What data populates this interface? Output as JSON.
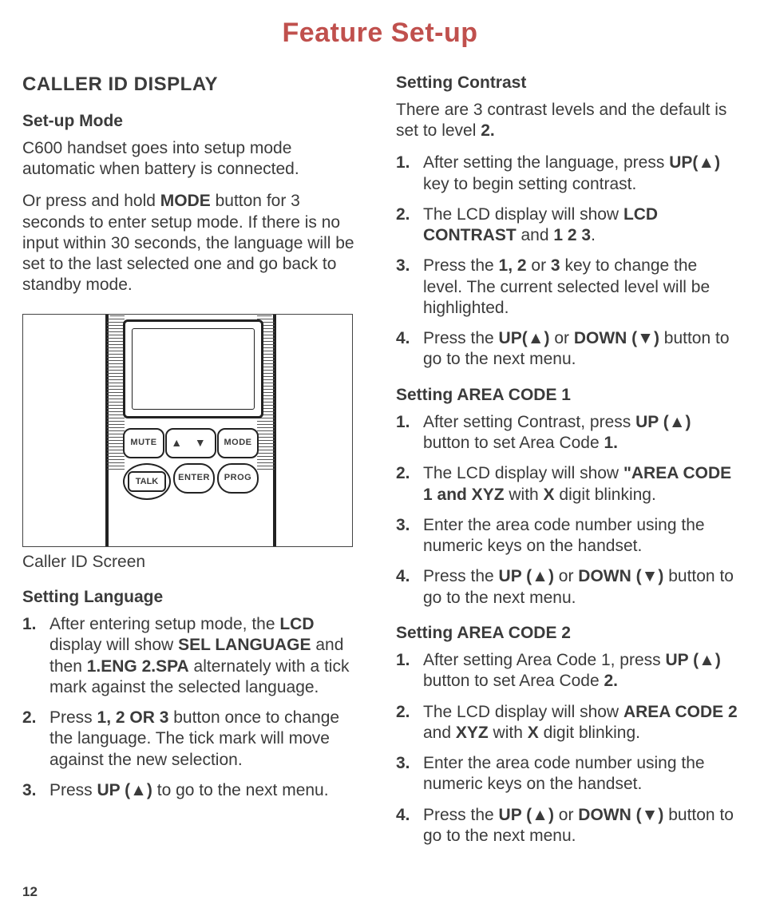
{
  "title": "Feature Set-up",
  "pageNumber": "12",
  "left": {
    "h2": "CALLER ID DISPLAY",
    "setupMode": {
      "heading": "Set-up Mode",
      "p1_a": "C600 handset goes into setup mode automatic when battery is connected.",
      "p2_a": "Or press and hold ",
      "p2_b": "MODE",
      "p2_c": " button for 3 seconds to enter setup mode. If there is no input within 30 seconds, the language will be set to the last selected one and go back to standby mode."
    },
    "device": {
      "btnMute": "MUTE",
      "btnMode": "MODE",
      "btnTalk": "TALK",
      "btnEnter": "ENTER",
      "btnProg": "PROG"
    },
    "caption": "Caller ID Screen",
    "lang": {
      "heading": "Setting Language",
      "i1_a": "After entering setup mode, the ",
      "i1_b": "LCD",
      "i1_c": " display will show ",
      "i1_d": "SEL LANGUAGE",
      "i1_e": " and then ",
      "i1_f": "1.ENG  2.SPA",
      "i1_g": " alternately with a tick mark against the selected language.",
      "i2_a": "Press ",
      "i2_b": "1, 2 OR 3",
      "i2_c": " button once to change the language. The tick mark will move against the new selection.",
      "i3_a": "Press ",
      "i3_b": "UP (▲)",
      "i3_c": " to go to the next menu."
    }
  },
  "right": {
    "contrast": {
      "heading": "Setting Contrast",
      "p_a": "There are 3 contrast levels and the default is set to level ",
      "p_b": "2.",
      "i1_a": "After setting the language, press ",
      "i1_b": "UP(▲)",
      "i1_c": " key to begin setting contrast.",
      "i2_a": "The LCD display will show ",
      "i2_b": "LCD CONTRAST",
      "i2_c": " and ",
      "i2_d": "1  2  3",
      "i2_e": ".",
      "i3_a": "Press the ",
      "i3_b": "1, 2",
      "i3_c": " or ",
      "i3_d": "3",
      "i3_e": " key to change the level. The current selected level will be highlighted.",
      "i4_a": "Press the ",
      "i4_b": "UP(▲)",
      "i4_c": " or ",
      "i4_d": "DOWN (▼)",
      "i4_e": "  button to go to the next menu."
    },
    "area1": {
      "heading": "Setting AREA CODE 1",
      "i1_a": "After setting Contrast, press ",
      "i1_b": "UP (▲)",
      "i1_c": " button to set Area Code ",
      "i1_d": "1.",
      "i2_a": "The LCD display will show ",
      "i2_b": "\"AREA CODE 1 and XYZ",
      "i2_c": " with ",
      "i2_d": "X",
      "i2_e": " digit blinking.",
      "i3": "Enter the area code number using the numeric keys on the handset.",
      "i4_a": "Press the ",
      "i4_b": "UP (▲)",
      "i4_c": " or ",
      "i4_d": "DOWN (▼)",
      "i4_e": " button to go   to the next menu."
    },
    "area2": {
      "heading": "Setting AREA CODE 2",
      "i1_a": "After setting Area Code 1, press ",
      "i1_b": "UP (▲)",
      "i1_c": " button to set Area Code ",
      "i1_d": "2.",
      "i2_a": "The LCD display will show ",
      "i2_b": "AREA CODE 2",
      "i2_c": " and ",
      "i2_d": "XYZ",
      "i2_e": " with ",
      "i2_f": "X",
      "i2_g": " digit blinking.",
      "i3": "Enter the area code number using the numeric keys on the handset.",
      "i4_a": "Press the ",
      "i4_b": "UP (▲)",
      "i4_c": "  or ",
      "i4_d": "DOWN (▼)",
      "i4_e": " button to go to the next menu."
    }
  }
}
